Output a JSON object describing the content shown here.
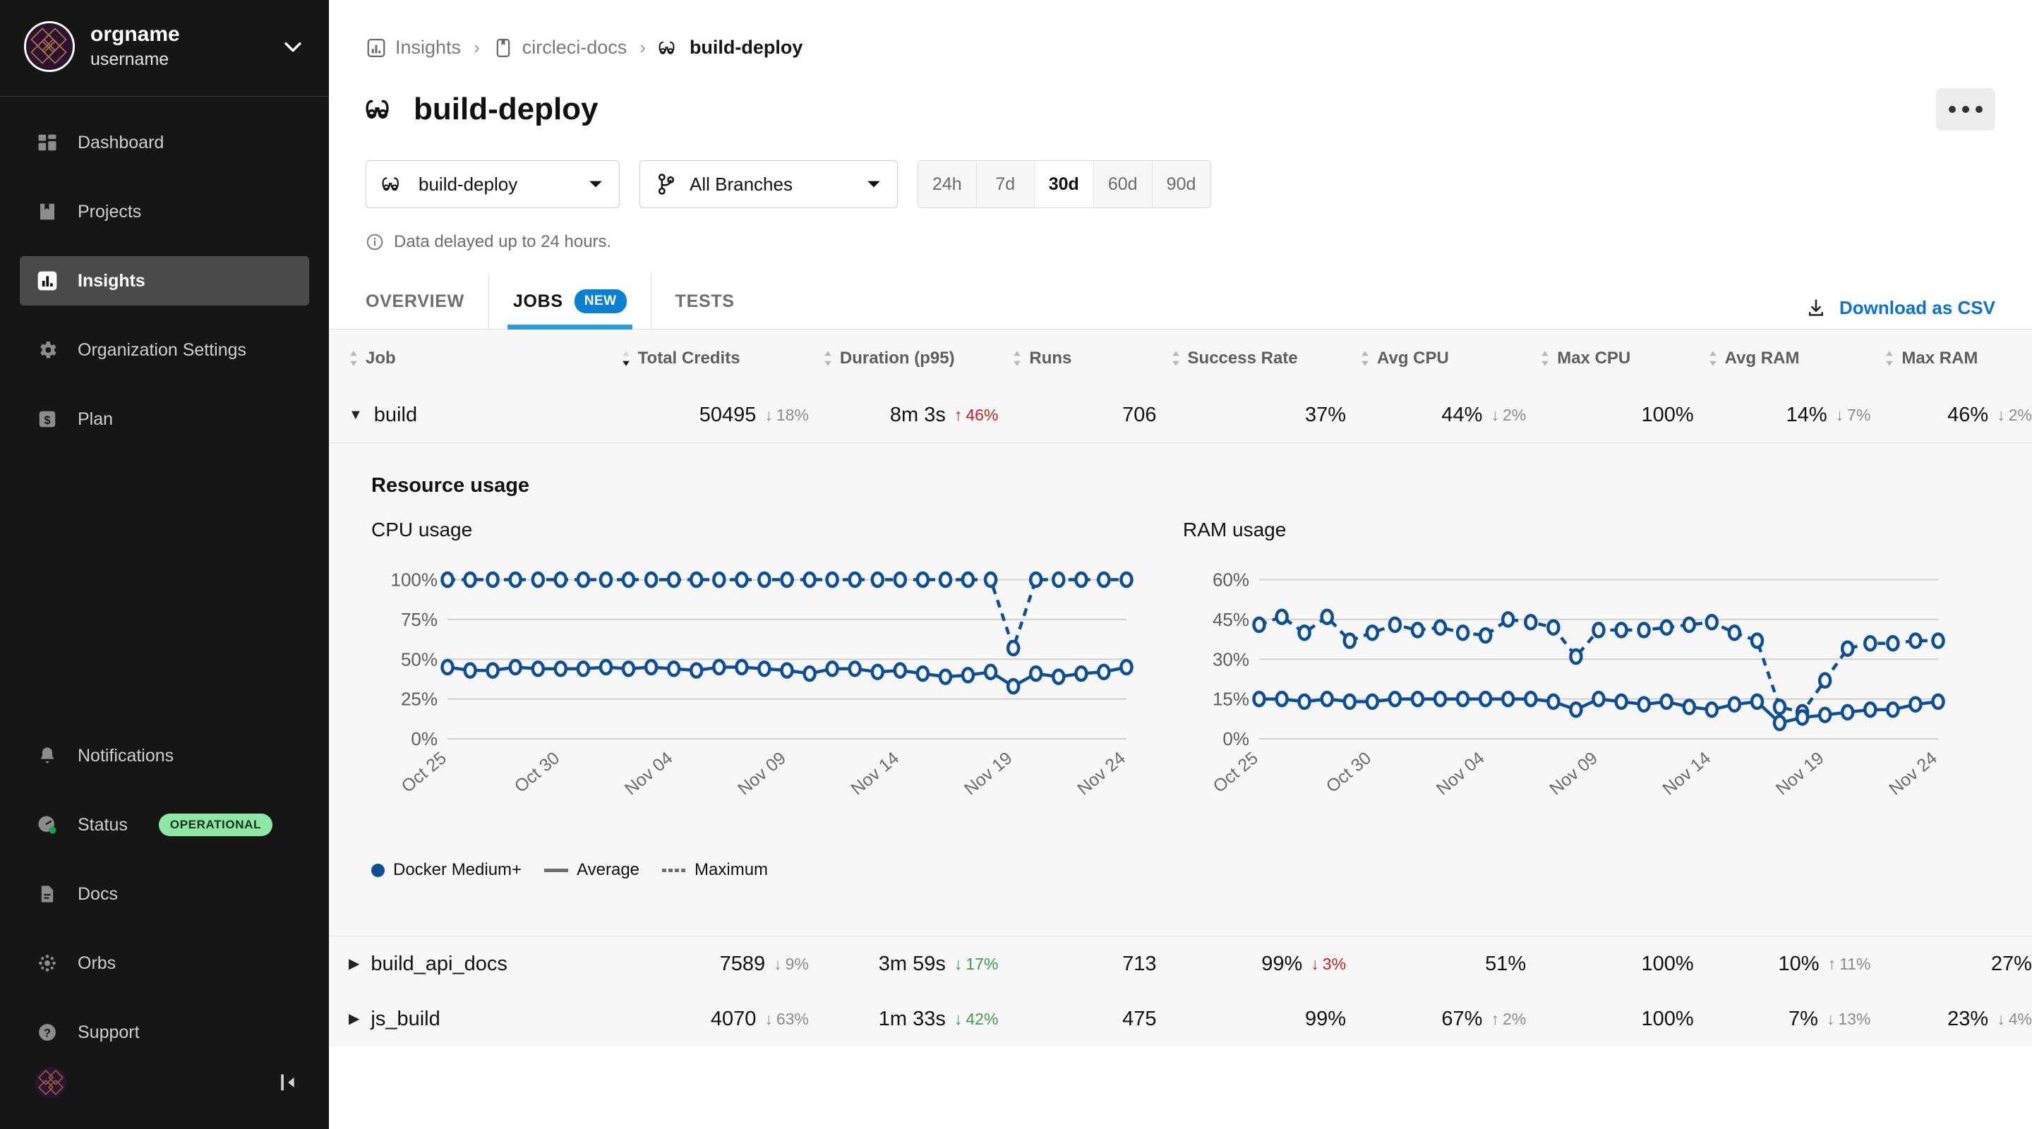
{
  "sidebar": {
    "org_name": "orgname",
    "username": "username",
    "main_items": [
      {
        "label": "Dashboard",
        "icon": "dashboard-icon",
        "active": false
      },
      {
        "label": "Projects",
        "icon": "projects-icon",
        "active": false
      },
      {
        "label": "Insights",
        "icon": "insights-icon",
        "active": true
      },
      {
        "label": "Organization Settings",
        "icon": "gear-icon",
        "active": false
      },
      {
        "label": "Plan",
        "icon": "dollar-icon",
        "active": false
      }
    ],
    "bottom_items": [
      {
        "label": "Notifications",
        "icon": "bell-icon"
      },
      {
        "label": "Status",
        "icon": "gauge-icon",
        "badge": "OPERATIONAL"
      },
      {
        "label": "Docs",
        "icon": "document-icon"
      },
      {
        "label": "Orbs",
        "icon": "orbs-icon"
      },
      {
        "label": "Support",
        "icon": "question-circle-icon"
      }
    ],
    "status_badge_color": "#8ee8a3"
  },
  "breadcrumb": [
    {
      "label": "Insights",
      "icon": "insights-icon"
    },
    {
      "label": "circleci-docs",
      "icon": "project-icon"
    },
    {
      "label": "build-deploy",
      "icon": "workflow-icon"
    }
  ],
  "header": {
    "title": "build-deploy",
    "title_icon": "workflow-icon",
    "kebab_label": "more-options"
  },
  "filters": {
    "workflow": {
      "value": "build-deploy",
      "icon": "workflow-icon"
    },
    "branch": {
      "value": "All Branches",
      "icon": "branch-icon"
    },
    "ranges": [
      "24h",
      "7d",
      "30d",
      "60d",
      "90d"
    ],
    "selected_range": "30d"
  },
  "notice": {
    "icon": "info-icon",
    "text": "Data delayed up to 24 hours."
  },
  "tabs": [
    {
      "label": "OVERVIEW",
      "active": false,
      "badge": null
    },
    {
      "label": "JOBS",
      "active": true,
      "badge": "NEW"
    },
    {
      "label": "TESTS",
      "active": false,
      "badge": null
    }
  ],
  "download": {
    "label": "Download as CSV",
    "icon": "download-icon",
    "color": "#0b72d1"
  },
  "table": {
    "columns": [
      {
        "label": "Job",
        "sorted": false
      },
      {
        "label": "Total Credits",
        "sorted": true,
        "direction": "desc"
      },
      {
        "label": "Duration (p95)",
        "sorted": false
      },
      {
        "label": "Runs",
        "sorted": false
      },
      {
        "label": "Success Rate",
        "sorted": false
      },
      {
        "label": "Avg CPU",
        "sorted": false
      },
      {
        "label": "Max CPU",
        "sorted": false
      },
      {
        "label": "Avg RAM",
        "sorted": false
      },
      {
        "label": "Max RAM",
        "sorted": false
      }
    ],
    "rows": [
      {
        "job": "build",
        "expanded": true,
        "credits": "50495",
        "credits_delta": "18%",
        "credits_dir": "down",
        "credits_color": "gray",
        "duration": "8m 3s",
        "duration_delta": "46%",
        "duration_dir": "up",
        "duration_color": "red",
        "runs": "706",
        "success": "37%",
        "success_delta": "",
        "success_dir": "",
        "success_color": "",
        "avg_cpu": "44%",
        "avg_cpu_delta": "2%",
        "avg_cpu_dir": "down",
        "avg_cpu_color": "gray",
        "max_cpu": "100%",
        "max_cpu_delta": "",
        "max_cpu_dir": "",
        "max_cpu_color": "",
        "avg_ram": "14%",
        "avg_ram_delta": "7%",
        "avg_ram_dir": "down",
        "avg_ram_color": "gray",
        "max_ram": "46%",
        "max_ram_delta": "2%",
        "max_ram_dir": "down",
        "max_ram_color": "gray"
      },
      {
        "job": "build_api_docs",
        "expanded": false,
        "credits": "7589",
        "credits_delta": "9%",
        "credits_dir": "down",
        "credits_color": "gray",
        "duration": "3m 59s",
        "duration_delta": "17%",
        "duration_dir": "down",
        "duration_color": "green",
        "runs": "713",
        "success": "99%",
        "success_delta": "3%",
        "success_dir": "down",
        "success_color": "red",
        "avg_cpu": "51%",
        "avg_cpu_delta": "",
        "avg_cpu_dir": "",
        "avg_cpu_color": "",
        "max_cpu": "100%",
        "max_cpu_delta": "",
        "max_cpu_dir": "",
        "max_cpu_color": "",
        "avg_ram": "10%",
        "avg_ram_delta": "11%",
        "avg_ram_dir": "up",
        "avg_ram_color": "gray",
        "max_ram": "27%",
        "max_ram_delta": "",
        "max_ram_dir": "",
        "max_ram_color": ""
      },
      {
        "job": "js_build",
        "expanded": false,
        "credits": "4070",
        "credits_delta": "63%",
        "credits_dir": "down",
        "credits_color": "gray",
        "duration": "1m 33s",
        "duration_delta": "42%",
        "duration_dir": "down",
        "duration_color": "green",
        "runs": "475",
        "success": "99%",
        "success_delta": "",
        "success_dir": "",
        "success_color": "",
        "avg_cpu": "67%",
        "avg_cpu_delta": "2%",
        "avg_cpu_dir": "up",
        "avg_cpu_color": "gray",
        "max_cpu": "100%",
        "max_cpu_delta": "",
        "max_cpu_dir": "",
        "max_cpu_color": "",
        "avg_ram": "7%",
        "avg_ram_delta": "13%",
        "avg_ram_dir": "down",
        "avg_ram_color": "gray",
        "max_ram": "23%",
        "max_ram_delta": "4%",
        "max_ram_dir": "down",
        "max_ram_color": "gray"
      }
    ]
  },
  "panel": {
    "title": "Resource usage",
    "legend": [
      {
        "label": "Docker Medium+",
        "marker": "dot"
      },
      {
        "label": "Average",
        "marker": "solid-line"
      },
      {
        "label": "Maximum",
        "marker": "dashed-line"
      }
    ]
  },
  "chart_data": [
    {
      "type": "line",
      "title": "CPU usage",
      "xlabel": "",
      "ylabel": "",
      "ylim": [
        0,
        110
      ],
      "yticks": [
        0,
        25,
        50,
        75,
        100
      ],
      "ytick_labels": [
        "0%",
        "25%",
        "50%",
        "75%",
        "100%"
      ],
      "grid": true,
      "legend_position": "bottom",
      "x_tick_labels": [
        "Oct 25",
        "Oct 30",
        "Nov 04",
        "Nov 09",
        "Nov 14",
        "Nov 19",
        "Nov 24"
      ],
      "x_tick_indices": [
        0,
        5,
        10,
        15,
        20,
        25,
        30
      ],
      "x": [
        "Oct 25",
        "Oct 26",
        "Oct 27",
        "Oct 28",
        "Oct 29",
        "Oct 30",
        "Oct 31",
        "Nov 01",
        "Nov 02",
        "Nov 03",
        "Nov 04",
        "Nov 05",
        "Nov 06",
        "Nov 07",
        "Nov 08",
        "Nov 09",
        "Nov 10",
        "Nov 11",
        "Nov 12",
        "Nov 13",
        "Nov 14",
        "Nov 15",
        "Nov 16",
        "Nov 17",
        "Nov 18",
        "Nov 19",
        "Nov 20",
        "Nov 21",
        "Nov 22",
        "Nov 23",
        "Nov 24"
      ],
      "series": [
        {
          "name": "Maximum",
          "style": "dashed",
          "values": [
            100,
            100,
            100,
            100,
            100,
            100,
            100,
            100,
            100,
            100,
            100,
            100,
            100,
            100,
            100,
            100,
            100,
            100,
            100,
            100,
            100,
            100,
            100,
            100,
            100,
            57,
            100,
            100,
            100,
            100,
            100
          ]
        },
        {
          "name": "Average",
          "style": "solid",
          "values": [
            45,
            43,
            43,
            45,
            44,
            44,
            44,
            45,
            44,
            45,
            44,
            43,
            45,
            45,
            44,
            43,
            41,
            44,
            44,
            42,
            43,
            41,
            39,
            40,
            42,
            33,
            41,
            39,
            41,
            42,
            45
          ]
        }
      ]
    },
    {
      "type": "line",
      "title": "RAM usage",
      "xlabel": "",
      "ylabel": "",
      "ylim": [
        0,
        66
      ],
      "yticks": [
        0,
        15,
        30,
        45,
        60
      ],
      "ytick_labels": [
        "0%",
        "15%",
        "30%",
        "45%",
        "60%"
      ],
      "grid": true,
      "legend_position": "bottom",
      "x_tick_labels": [
        "Oct 25",
        "Oct 30",
        "Nov 04",
        "Nov 09",
        "Nov 14",
        "Nov 19",
        "Nov 24"
      ],
      "x_tick_indices": [
        0,
        5,
        10,
        15,
        20,
        25,
        30
      ],
      "x": [
        "Oct 25",
        "Oct 26",
        "Oct 27",
        "Oct 28",
        "Oct 29",
        "Oct 30",
        "Oct 31",
        "Nov 01",
        "Nov 02",
        "Nov 03",
        "Nov 04",
        "Nov 05",
        "Nov 06",
        "Nov 07",
        "Nov 08",
        "Nov 09",
        "Nov 10",
        "Nov 11",
        "Nov 12",
        "Nov 13",
        "Nov 14",
        "Nov 15",
        "Nov 16",
        "Nov 17",
        "Nov 18",
        "Nov 19",
        "Nov 20",
        "Nov 21",
        "Nov 22",
        "Nov 23",
        "Nov 24"
      ],
      "series": [
        {
          "name": "Maximum",
          "style": "dashed",
          "values": [
            43,
            46,
            40,
            46,
            37,
            40,
            43,
            41,
            42,
            40,
            39,
            45,
            44,
            42,
            31,
            41,
            41,
            41,
            42,
            43,
            44,
            40,
            37,
            12,
            10,
            22,
            34,
            36,
            36,
            37,
            37
          ]
        },
        {
          "name": "Average",
          "style": "solid",
          "values": [
            15,
            15,
            14,
            15,
            14,
            14,
            15,
            15,
            15,
            15,
            15,
            15,
            15,
            14,
            11,
            15,
            14,
            13,
            14,
            12,
            11,
            13,
            14,
            6,
            8,
            9,
            10,
            11,
            11,
            13,
            14
          ]
        }
      ]
    }
  ]
}
